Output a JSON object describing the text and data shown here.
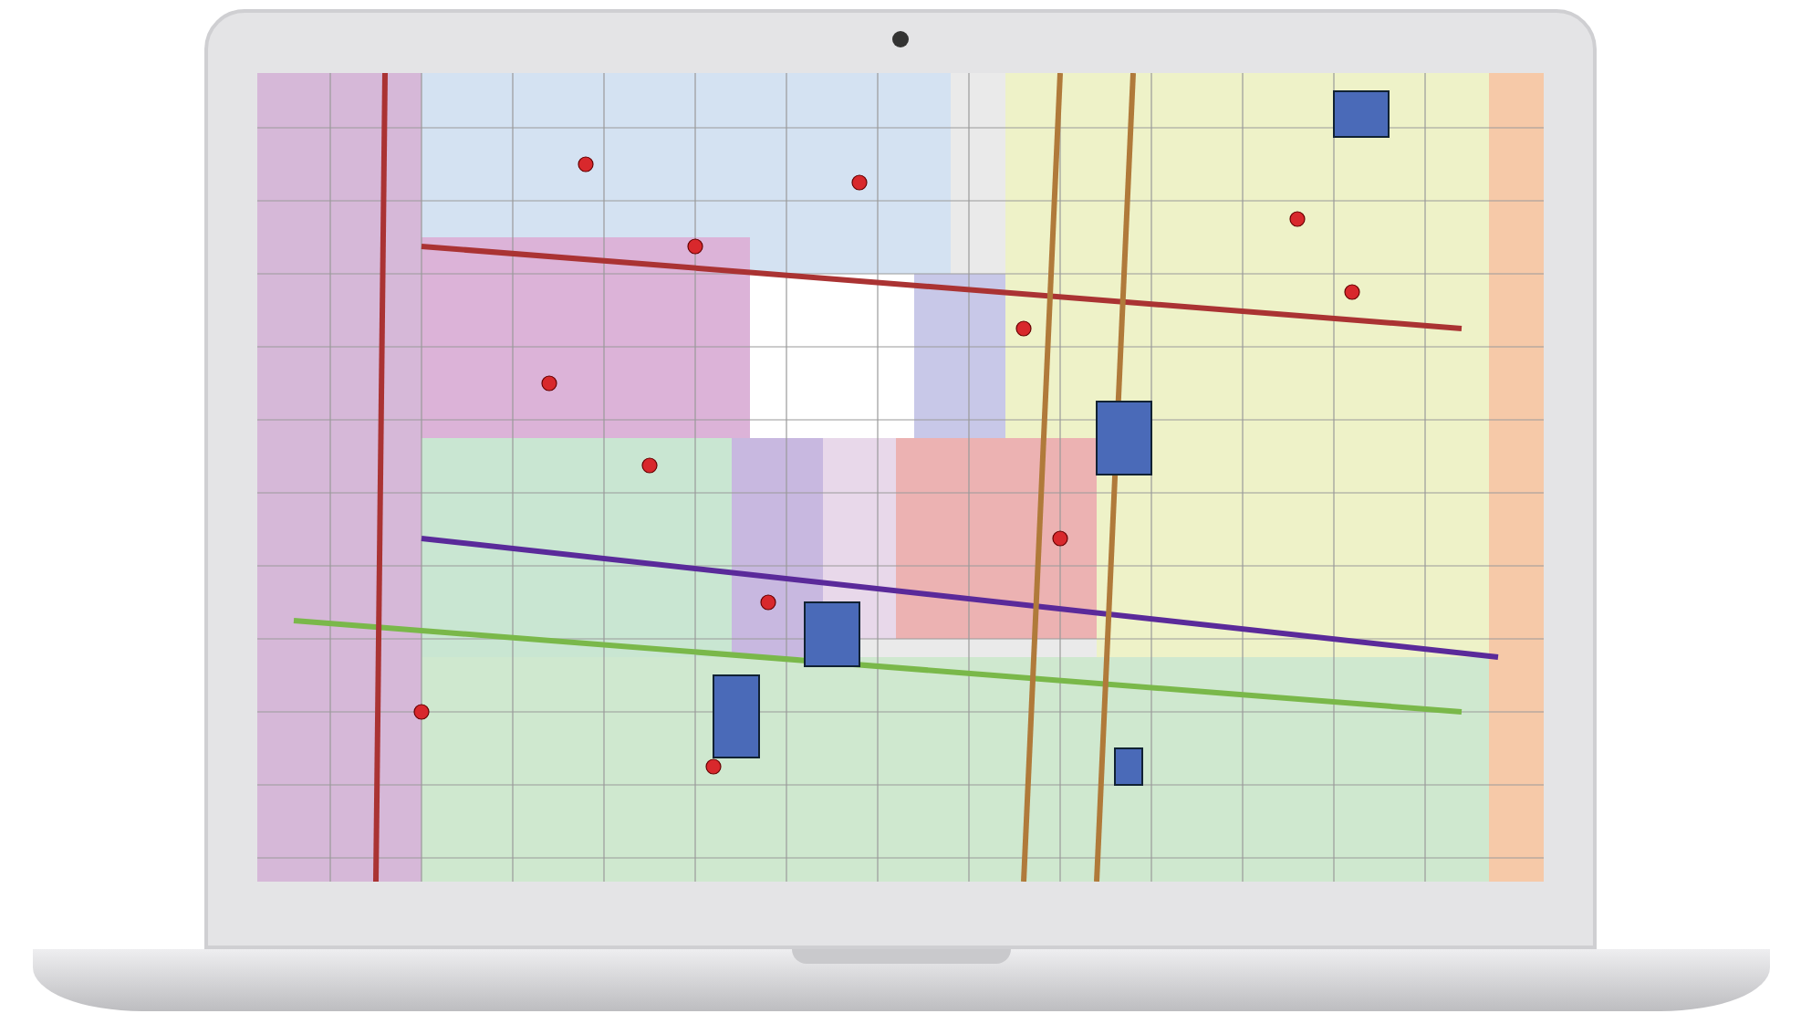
{
  "device": {
    "kind": "laptop"
  },
  "screen": {
    "kind": "map"
  }
}
